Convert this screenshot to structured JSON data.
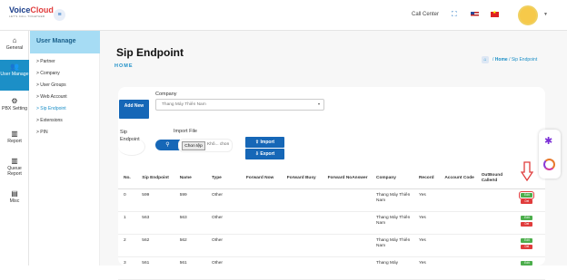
{
  "brand": {
    "name_part1": "Voice",
    "name_part2": "Cloud",
    "tagline": "LET'S CALL TOGETHER"
  },
  "header": {
    "call_center": "Call Center"
  },
  "left_nav": [
    {
      "label": "General",
      "icon": "home-icon"
    },
    {
      "label": "User Manage",
      "icon": "users-icon",
      "active": true
    },
    {
      "label": "PBX Setting",
      "icon": "gear-icon"
    },
    {
      "label": "Report",
      "icon": "bar-chart-icon"
    },
    {
      "label": "Queue Report",
      "icon": "bar-chart-icon"
    },
    {
      "label": "Misc",
      "icon": "document-icon"
    }
  ],
  "sub_nav": {
    "title": "User Manage",
    "items": [
      "> Partner",
      "> Company",
      "> User Groups",
      "> Web Account",
      "> Sip Endpoint",
      "> Extensions",
      "> PIN"
    ],
    "active_index": 4
  },
  "page": {
    "title": "Sip Endpoint",
    "subtitle": "HOME",
    "breadcrumb_home": "Home",
    "breadcrumb_current": "Sip Endpoint",
    "breadcrumb_sep": "/"
  },
  "form": {
    "add_new": "Add New",
    "company_label": "Company",
    "company_value": "Thang Máy Thiên Nam",
    "sip_endpoint_label": "Sip Endpoint",
    "import_file_label": "Import File",
    "choose_file": "Chon tệp",
    "no_file": "Khô... chon",
    "import_btn": "Import",
    "export_btn": "Export"
  },
  "table": {
    "headers": [
      "No.",
      "Sip Endpoint",
      "Name",
      "Type",
      "Forward Now",
      "Forward Busy",
      "Forward NoAnswer",
      "Company",
      "Record",
      "Account Code",
      "OutBound CallerId",
      ""
    ],
    "rows": [
      {
        "no": "0",
        "sip": "599",
        "name": "599",
        "type": "Other",
        "company": "Thang Máy Thiên Nam",
        "record": "Yes"
      },
      {
        "no": "1",
        "sip": "563",
        "name": "563",
        "type": "Other",
        "company": "Thang Máy Thiên Nam",
        "record": "Yes"
      },
      {
        "no": "2",
        "sip": "562",
        "name": "562",
        "type": "Other",
        "company": "Thang Máy Thiên Nam",
        "record": "Yes"
      },
      {
        "no": "3",
        "sip": "561",
        "name": "561",
        "type": "Other",
        "company": "Thang Máy",
        "record": "Yes"
      }
    ],
    "edit_label": "Edit",
    "del_label": "Del"
  },
  "colors": {
    "primary": "#1667b7",
    "accent": "#1c8fc7",
    "edit": "#4cae4c",
    "delete": "#e03c3c",
    "highlight": "#e03c3c"
  }
}
